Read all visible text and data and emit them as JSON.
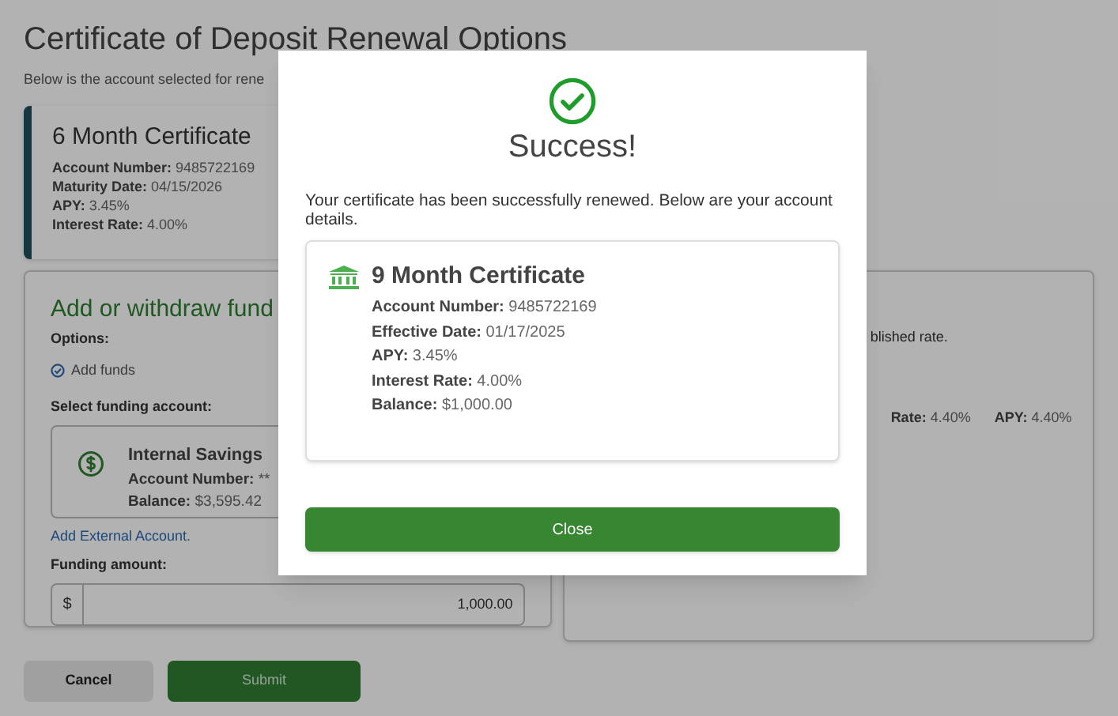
{
  "page": {
    "title": "Certificate of Deposit Renewal Options",
    "subtitle": "Below is the account selected for rene",
    "current_certificate": {
      "title": "6 Month Certificate",
      "fields": [
        {
          "label": "Account Number:",
          "value": "9485722169"
        },
        {
          "label": "Maturity Date:",
          "value": "04/15/2026"
        },
        {
          "label": "APY:",
          "value": "3.45%"
        },
        {
          "label": "Interest Rate:",
          "value": "4.00%"
        }
      ]
    },
    "funds": {
      "heading": "Add or withdraw fund",
      "options_label": "Options:",
      "options": [
        {
          "label": "Add funds",
          "selected": true
        }
      ],
      "funding_label": "Select funding account:",
      "account": {
        "name": "Internal Savings",
        "fields": [
          {
            "label": "Account Number:",
            "value": "**"
          },
          {
            "label": "Balance:",
            "value": "$3,595.42"
          }
        ]
      },
      "add_external_link": "Add External Account.",
      "amount_label": "Funding amount:",
      "amount": {
        "prefix": "$",
        "value": "1,000.00"
      }
    },
    "rate_panel": {
      "note": "blished rate.",
      "fields": [
        {
          "label": "Rate:",
          "value": "4.40%"
        },
        {
          "label": "APY:",
          "value": "4.40%"
        }
      ]
    },
    "buttons": [
      {
        "label": "Cancel",
        "kind": "secondary"
      },
      {
        "label": "Submit",
        "kind": "primary"
      }
    ]
  },
  "modal": {
    "title": "Success!",
    "message": "Your certificate has been successfully renewed. Below are your account details.",
    "certificate": {
      "title": "9 Month Certificate",
      "fields": [
        {
          "label": "Account Number:",
          "value": "9485722169"
        },
        {
          "label": "Effective Date:",
          "value": "01/17/2025"
        },
        {
          "label": "APY:",
          "value": "3.45%"
        },
        {
          "label": "Interest Rate:",
          "value": "4.00%"
        },
        {
          "label": "Balance:",
          "value": "$1,000.00"
        }
      ]
    },
    "close_button": "Close"
  }
}
